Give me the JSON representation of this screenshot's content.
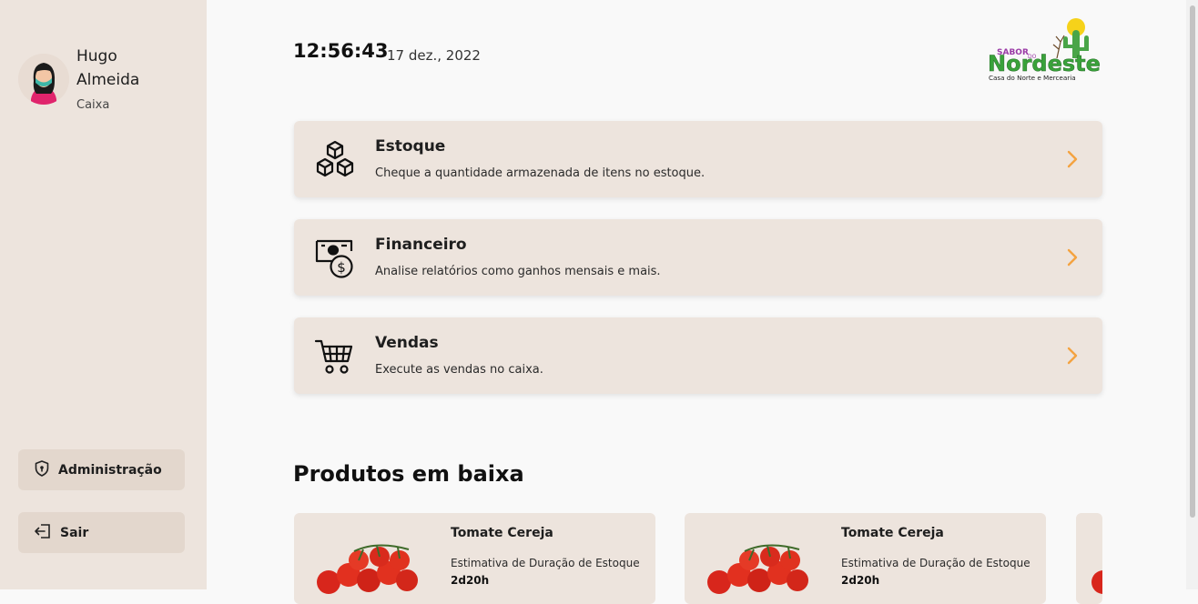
{
  "user": {
    "first_name": "Hugo",
    "last_name": "Almeida",
    "role": "Caixa"
  },
  "sidebar": {
    "admin_label": "Administração",
    "logout_label": "Sair"
  },
  "header": {
    "time": "12:56:43",
    "date": "17 dez., 2022"
  },
  "logo": {
    "line1": "SABOR",
    "line2": "DO",
    "brand": "Nordeste",
    "tagline": "Casa do Norte e Mercearia"
  },
  "menu": [
    {
      "title": "Estoque",
      "description": "Cheque a quantidade armazenada de itens no estoque.",
      "icon": "boxes-icon"
    },
    {
      "title": "Financeiro",
      "description": "Analise relatórios como ganhos mensais e mais.",
      "icon": "money-icon"
    },
    {
      "title": "Vendas",
      "description": "Execute as vendas no caixa.",
      "icon": "cart-icon"
    }
  ],
  "low_stock": {
    "title": "Produtos em baixa",
    "items": [
      {
        "name": "Tomate Cereja",
        "label": "Estimativa de Duração de Estoque",
        "value": "2d20h"
      },
      {
        "name": "Tomate Cereja",
        "label": "Estimativa de Duração de Estoque",
        "value": "2d20h"
      }
    ]
  },
  "colors": {
    "accent": "#f4a340",
    "card_bg": "#ede4dd",
    "sidebar_bg": "#ede4dd"
  }
}
